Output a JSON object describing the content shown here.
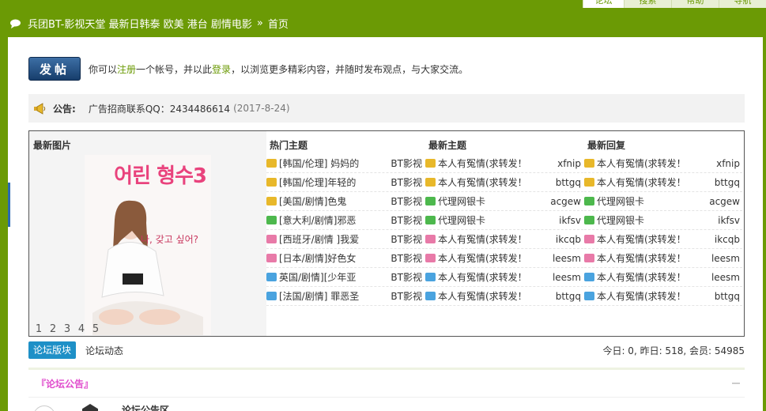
{
  "top_tabs": [
    {
      "label": "论坛",
      "active": true,
      "width": 52
    },
    {
      "label": "搜索",
      "active": false,
      "width": 60
    },
    {
      "label": "帮助",
      "active": false,
      "width": 60
    },
    {
      "label": "导航",
      "active": false,
      "width": 60
    }
  ],
  "breadcrumb": {
    "site": "兵团BT-影视天堂 最新日韩泰 欧美 港台 剧情电影",
    "separator": "»",
    "current": "首页"
  },
  "post": {
    "button_label": "发帖",
    "text_prefix": "你可以",
    "register_link": "注册",
    "text_middle": "一个帐号，并以此",
    "login_link": "登录",
    "text_suffix": "，以浏览更多精彩内容，并随时发布观点，与大家交流。"
  },
  "notice": {
    "label": "公告:",
    "text": "广告招商联系QQ：2434486614",
    "date": "(2017-8-24)"
  },
  "portal": {
    "pic_title": "最新图片",
    "poster_title": "어린 형수3",
    "poster_side": "나, 갖고 싶어?",
    "pager": [
      "1",
      "2",
      "3",
      "4",
      "5"
    ],
    "hot": {
      "title": "热门主题",
      "rows": [
        {
          "t": "[韩国/伦理] 妈妈的",
          "a": "BT影视",
          "color": "#e8b82a"
        },
        {
          "t": "[韩国/伦理]年轻的",
          "a": "BT影视",
          "color": "#e8b82a"
        },
        {
          "t": "[美国/剧情]色鬼",
          "a": "BT影视",
          "color": "#e8b82a"
        },
        {
          "t": "[意大利/剧情]邪恶",
          "a": "BT影视",
          "color": "#4db84d"
        },
        {
          "t": "[西班牙/剧情 ]我爱",
          "a": "BT影视",
          "color": "#e87aa8"
        },
        {
          "t": "[日本/剧情]好色女",
          "a": "BT影视",
          "color": "#e87aa8"
        },
        {
          "t": "英国/剧情][少年亚",
          "a": "BT影视",
          "color": "#4aa3df"
        },
        {
          "t": "[法国/剧情] 罪恶圣",
          "a": "BT影视",
          "color": "#4aa3df"
        }
      ]
    },
    "latest": {
      "title": "最新主题",
      "rows": [
        {
          "t": "本人有冤情(求转发！",
          "a": "xfnip",
          "color": "#e8b82a"
        },
        {
          "t": "本人有冤情(求转发！",
          "a": "bttgq",
          "color": "#e8b82a"
        },
        {
          "t": "代理网银卡",
          "a": "acgew",
          "color": "#4db84d"
        },
        {
          "t": "代理网银卡",
          "a": "ikfsv",
          "color": "#4db84d"
        },
        {
          "t": "本人有冤情(求转发！",
          "a": "ikcqb",
          "color": "#e87aa8"
        },
        {
          "t": "本人有冤情(求转发！",
          "a": "leesm",
          "color": "#e87aa8"
        },
        {
          "t": "本人有冤情(求转发！",
          "a": "leesm",
          "color": "#4aa3df"
        },
        {
          "t": "本人有冤情(求转发！",
          "a": "bttgq",
          "color": "#4aa3df"
        }
      ]
    },
    "reply": {
      "title": "最新回复",
      "rows": [
        {
          "t": "本人有冤情(求转发！",
          "a": "xfnip",
          "color": "#e8b82a"
        },
        {
          "t": "本人有冤情(求转发！",
          "a": "bttgq",
          "color": "#e8b82a"
        },
        {
          "t": "代理网银卡",
          "a": "acgew",
          "color": "#4db84d"
        },
        {
          "t": "代理网银卡",
          "a": "ikfsv",
          "color": "#4db84d"
        },
        {
          "t": "本人有冤情(求转发！",
          "a": "ikcqb",
          "color": "#e87aa8"
        },
        {
          "t": "本人有冤情(求转发！",
          "a": "leesm",
          "color": "#e87aa8"
        },
        {
          "t": "本人有冤情(求转发！",
          "a": "leesm",
          "color": "#4aa3df"
        },
        {
          "t": "本人有冤情(求转发！",
          "a": "bttgq",
          "color": "#4aa3df"
        }
      ]
    }
  },
  "tabs": {
    "active": "论坛版块",
    "other": "论坛动态"
  },
  "stats": "今日: 0, 昨日: 518, 会员: 54985",
  "section": {
    "title": "『论坛公告』"
  },
  "forum": {
    "name": "论坛公告区"
  }
}
